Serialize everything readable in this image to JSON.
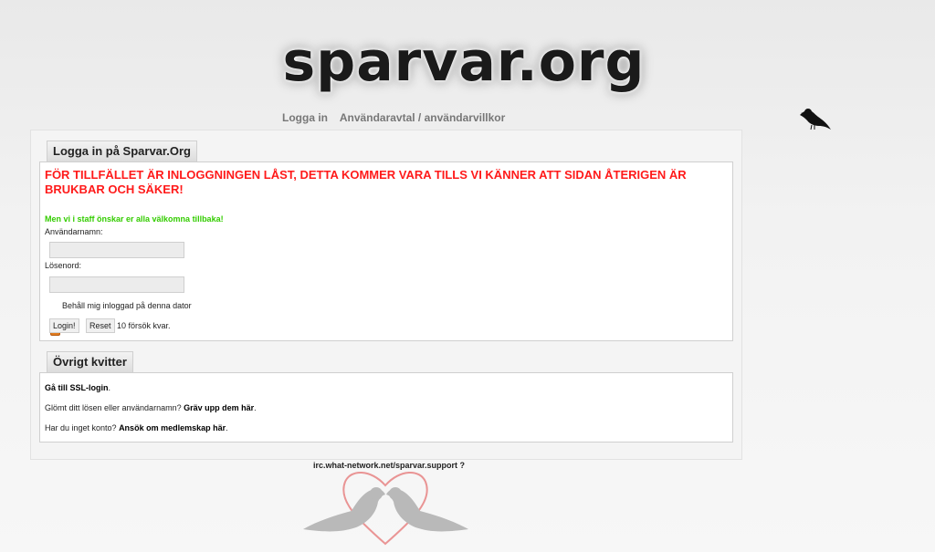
{
  "logo": {
    "text": "sparvar.org"
  },
  "nav": {
    "items": [
      {
        "label": "Logga in"
      },
      {
        "label": "Användaravtal / användarvillkor"
      }
    ]
  },
  "login": {
    "tab": "Logga in på Sparvar.Org",
    "warning": "FÖR TILLFÄLLET ÄR INLOGGNINGEN LÅST, DETTA KOMMER VARA TILLS VI KÄNNER ATT SIDAN ÅTERIGEN ÄR BRUKBAR OCH SÄKER!",
    "welcome": "Men vi i staff önskar er alla välkomna tillbaka!",
    "username_label": "Användarnamn:",
    "username_value": "",
    "password_label": "Lösenord:",
    "password_value": "",
    "remember_label": "Behåll mig inloggad på denna dator",
    "remember_checked": true,
    "login_button": "Login!",
    "reset_button": "Reset",
    "tries_text": "10 försök kvar."
  },
  "misc": {
    "tab": "Övrigt kvitter",
    "ssl_link": "Gå till SSL-login",
    "ssl_suffix": ".",
    "forgot_prefix": "Glömt ditt lösen eller användarnamn? ",
    "forgot_link": "Gräv upp dem här",
    "forgot_suffix": ".",
    "signup_prefix": "Har du inget konto? ",
    "signup_link": "Ansök om medlemskap här",
    "signup_suffix": "."
  },
  "footer": {
    "irc": "irc.what-network.net/sparvar.support ?"
  },
  "colors": {
    "warning": "#ff1a1a",
    "welcome": "#33cc00",
    "checkbox": "#e07b1e",
    "heart": "#e88a8a"
  },
  "icons": [
    "bird-icon",
    "kissing-birds-heart-icon",
    "check-icon"
  ]
}
